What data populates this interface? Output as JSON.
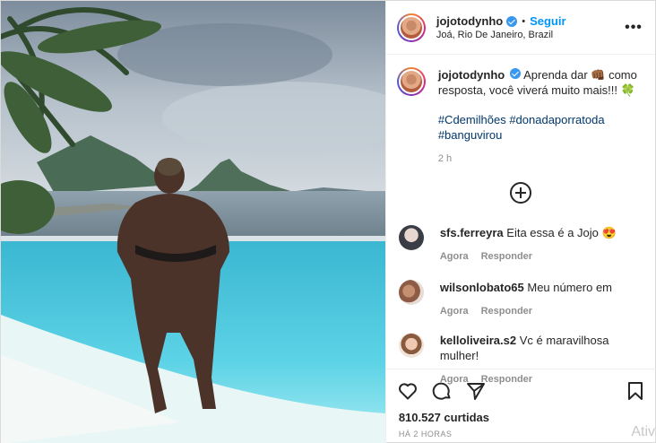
{
  "post": {
    "username": "jojotodynho",
    "follow_label": "Seguir",
    "separator": "•",
    "location": "Joá, Rio De Janeiro, Brazil",
    "more_label": "•••",
    "caption_text": "Aprenda dar 👊🏾 como resposta, você viverá muito mais!!! 🍀",
    "hashtags": "#Cdemilhões #donadaporratoda #banguvirou",
    "time": "2 h",
    "likes": "810.527 curtidas",
    "posted_ago": "HÁ 2 HORAS"
  },
  "comments": [
    {
      "username": "sfs.ferreyra",
      "text": "Eita essa é a Jojo 😍",
      "time": "Agora",
      "reply": "Responder"
    },
    {
      "username": "wilsonlobato65",
      "text": "Meu número em",
      "time": "Agora",
      "reply": "Responder"
    },
    {
      "username": "kelloliveira.s2",
      "text": "Vc é maravilhosa mulher!",
      "time": "Agora",
      "reply": "Responder"
    }
  ],
  "overlay": {
    "activate_text": "Ativ"
  },
  "icons": [
    "verified-icon",
    "more-options-icon",
    "load-more-icon",
    "heart-icon",
    "comment-icon",
    "share-icon",
    "bookmark-icon"
  ],
  "colors": {
    "link_blue": "#0095f6",
    "hashtag": "#00376b",
    "muted": "#8e8e8e",
    "pool": "#46c6df"
  }
}
